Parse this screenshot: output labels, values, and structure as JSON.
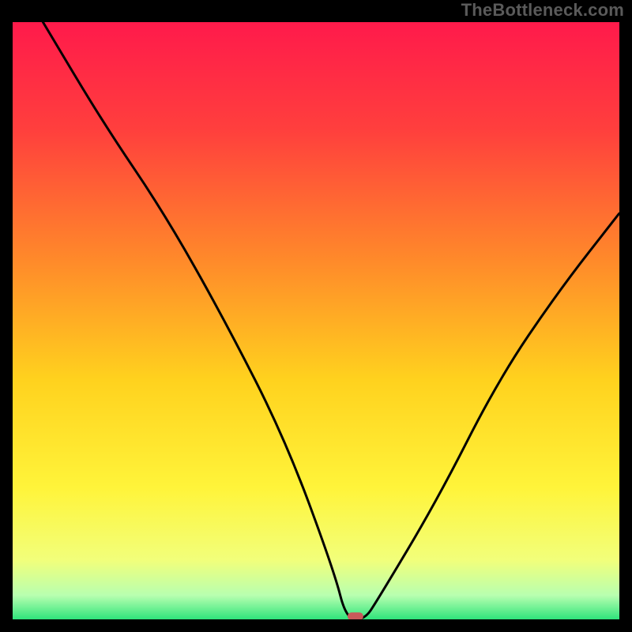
{
  "watermark": "TheBottleneck.com",
  "chart_data": {
    "type": "line",
    "title": "",
    "xlabel": "",
    "ylabel": "",
    "xlim": [
      0,
      100
    ],
    "ylim": [
      0,
      100
    ],
    "grid": false,
    "series": [
      {
        "name": "bottleneck-curve",
        "x": [
          5,
          15,
          25,
          35,
          45,
          53,
          55,
          58,
          60,
          70,
          80,
          90,
          100
        ],
        "values": [
          100,
          83,
          68,
          50,
          30,
          8,
          0,
          0,
          3,
          20,
          40,
          55,
          68
        ]
      }
    ],
    "marker": {
      "x": 56.5,
      "y": 0.5
    },
    "gradient_stops": [
      {
        "offset": 0,
        "color": "#ff1a4b"
      },
      {
        "offset": 18,
        "color": "#ff3f3d"
      },
      {
        "offset": 40,
        "color": "#ff8a2a"
      },
      {
        "offset": 60,
        "color": "#ffd21e"
      },
      {
        "offset": 78,
        "color": "#fff43a"
      },
      {
        "offset": 90,
        "color": "#f2ff7a"
      },
      {
        "offset": 96,
        "color": "#b8ffb0"
      },
      {
        "offset": 100,
        "color": "#2fe47b"
      }
    ],
    "colors": {
      "frame": "#000000",
      "curve": "#000000",
      "marker": "#c85a5a"
    }
  }
}
